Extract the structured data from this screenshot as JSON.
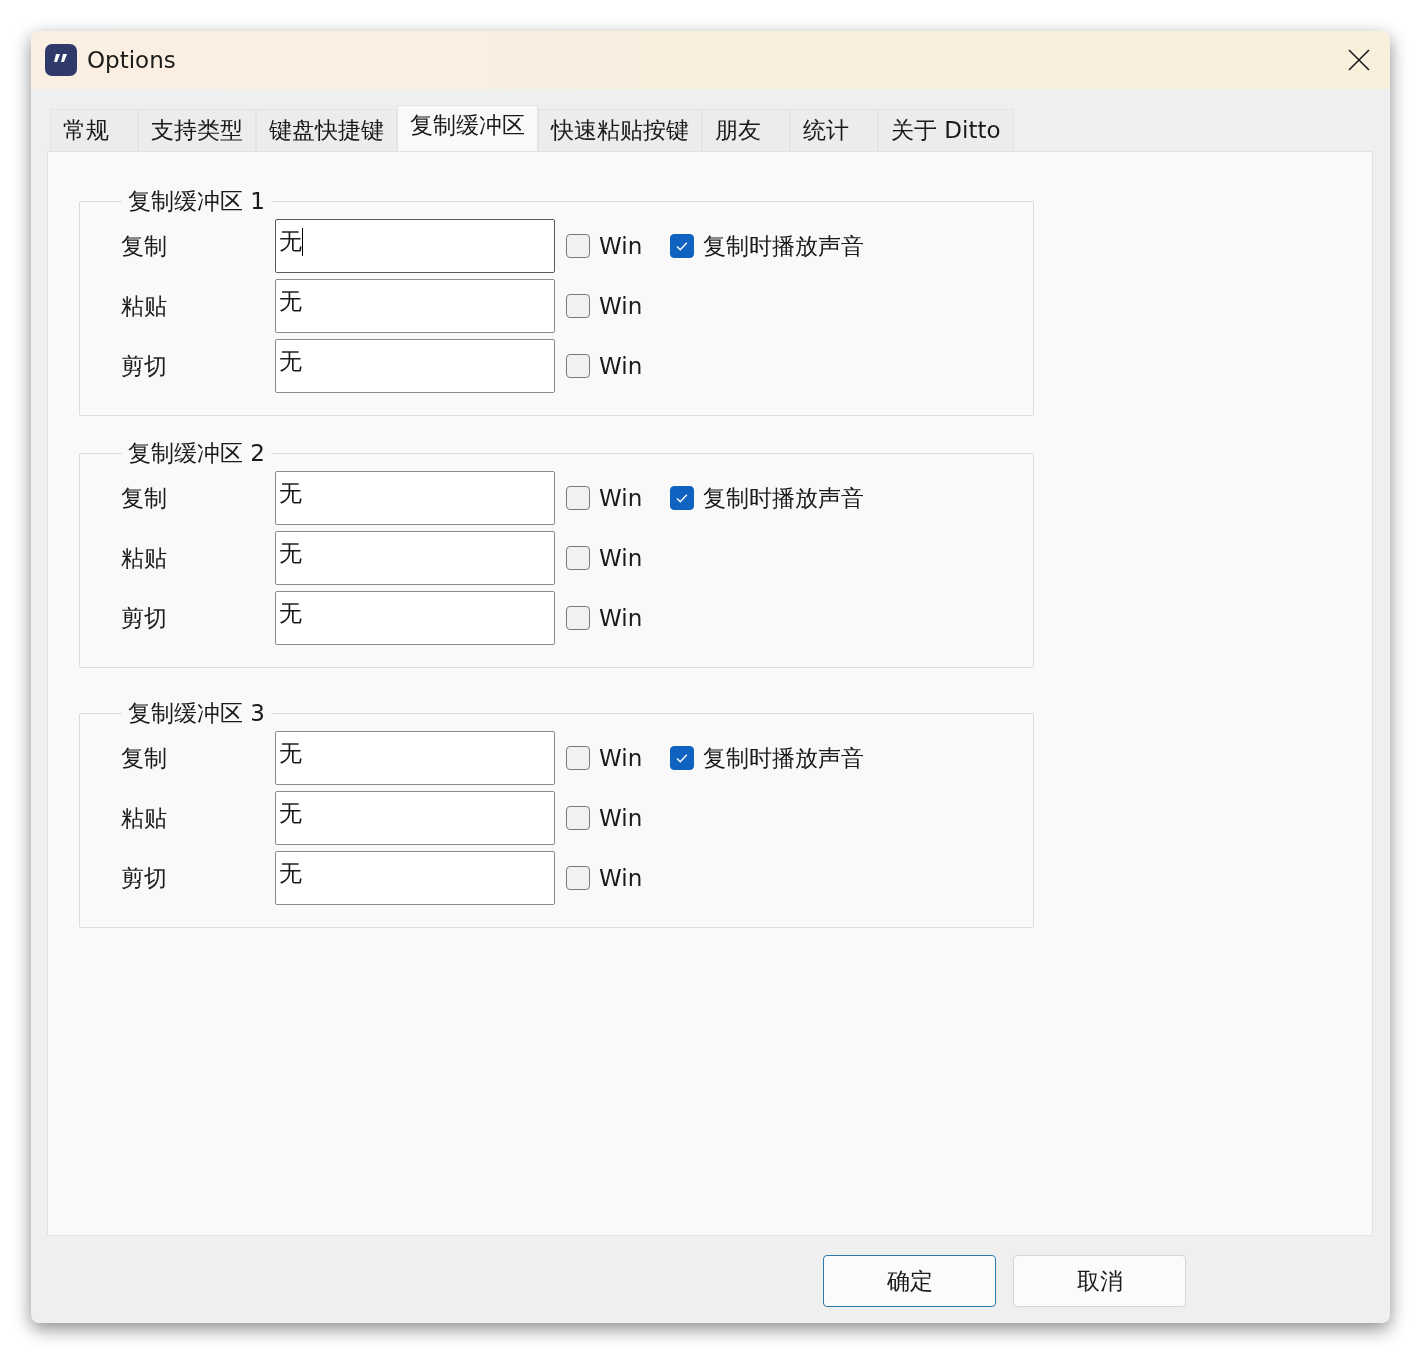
{
  "window": {
    "title": "Options"
  },
  "tabs": [
    {
      "label": "常规",
      "selected": false
    },
    {
      "label": "支持类型",
      "selected": false
    },
    {
      "label": "键盘快捷键",
      "selected": false
    },
    {
      "label": "复制缓冲区",
      "selected": true
    },
    {
      "label": "快速粘贴按键",
      "selected": false
    },
    {
      "label": "朋友",
      "selected": false
    },
    {
      "label": "统计",
      "selected": false
    },
    {
      "label": "关于 Ditto",
      "selected": false
    }
  ],
  "groups": [
    {
      "title": "复制缓冲区 1",
      "sound": {
        "label": "复制时播放声音",
        "checked": true
      },
      "rows": [
        {
          "label": "复制",
          "value": "无",
          "focused": true,
          "win": {
            "label": "Win",
            "checked": false
          }
        },
        {
          "label": "粘贴",
          "value": "无",
          "focused": false,
          "win": {
            "label": "Win",
            "checked": false
          }
        },
        {
          "label": "剪切",
          "value": "无",
          "focused": false,
          "win": {
            "label": "Win",
            "checked": false
          }
        }
      ]
    },
    {
      "title": "复制缓冲区 2",
      "sound": {
        "label": "复制时播放声音",
        "checked": true
      },
      "rows": [
        {
          "label": "复制",
          "value": "无",
          "focused": false,
          "win": {
            "label": "Win",
            "checked": false
          }
        },
        {
          "label": "粘贴",
          "value": "无",
          "focused": false,
          "win": {
            "label": "Win",
            "checked": false
          }
        },
        {
          "label": "剪切",
          "value": "无",
          "focused": false,
          "win": {
            "label": "Win",
            "checked": false
          }
        }
      ]
    },
    {
      "title": "复制缓冲区 3",
      "sound": {
        "label": "复制时播放声音",
        "checked": true
      },
      "rows": [
        {
          "label": "复制",
          "value": "无",
          "focused": false,
          "win": {
            "label": "Win",
            "checked": false
          }
        },
        {
          "label": "粘贴",
          "value": "无",
          "focused": false,
          "win": {
            "label": "Win",
            "checked": false
          }
        },
        {
          "label": "剪切",
          "value": "无",
          "focused": false,
          "win": {
            "label": "Win",
            "checked": false
          }
        }
      ]
    }
  ],
  "buttons": [
    {
      "label": "确定",
      "default": true
    },
    {
      "label": "取消",
      "default": false
    }
  ]
}
